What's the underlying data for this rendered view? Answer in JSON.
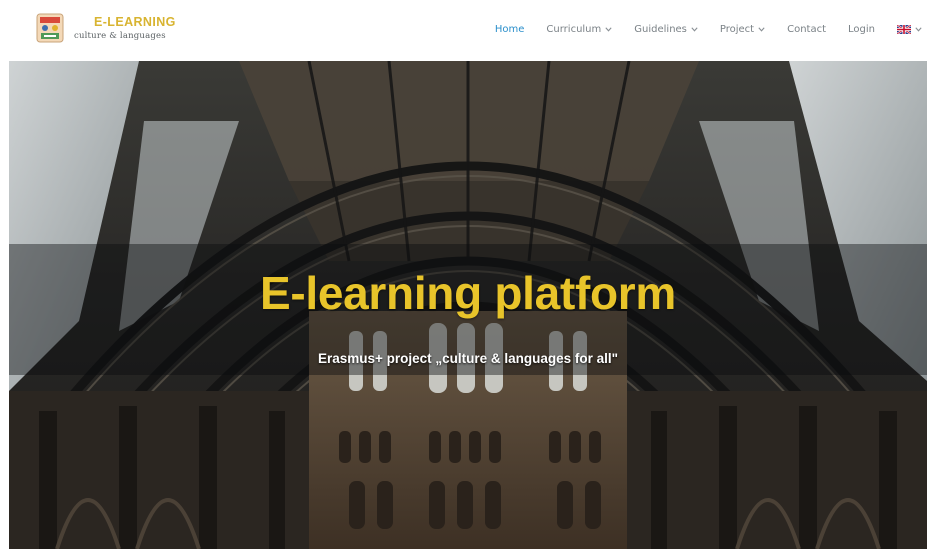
{
  "header": {
    "logo": {
      "title": "E-LEARNING",
      "subtitle": "culture & languages"
    },
    "nav": {
      "home": "Home",
      "curriculum": "Curriculum",
      "guidelines": "Guidelines",
      "project": "Project",
      "contact": "Contact",
      "login": "Login",
      "language_flag_icon": "uk-flag-icon"
    },
    "colors": {
      "accent": "#2b8fcb",
      "nav_text": "#7b8287",
      "logo_gold": "#d8b431"
    }
  },
  "hero": {
    "title": "E-learning platform",
    "subtitle": "Erasmus+ project „culture & languages for all\"",
    "title_color": "#e8c42a"
  }
}
